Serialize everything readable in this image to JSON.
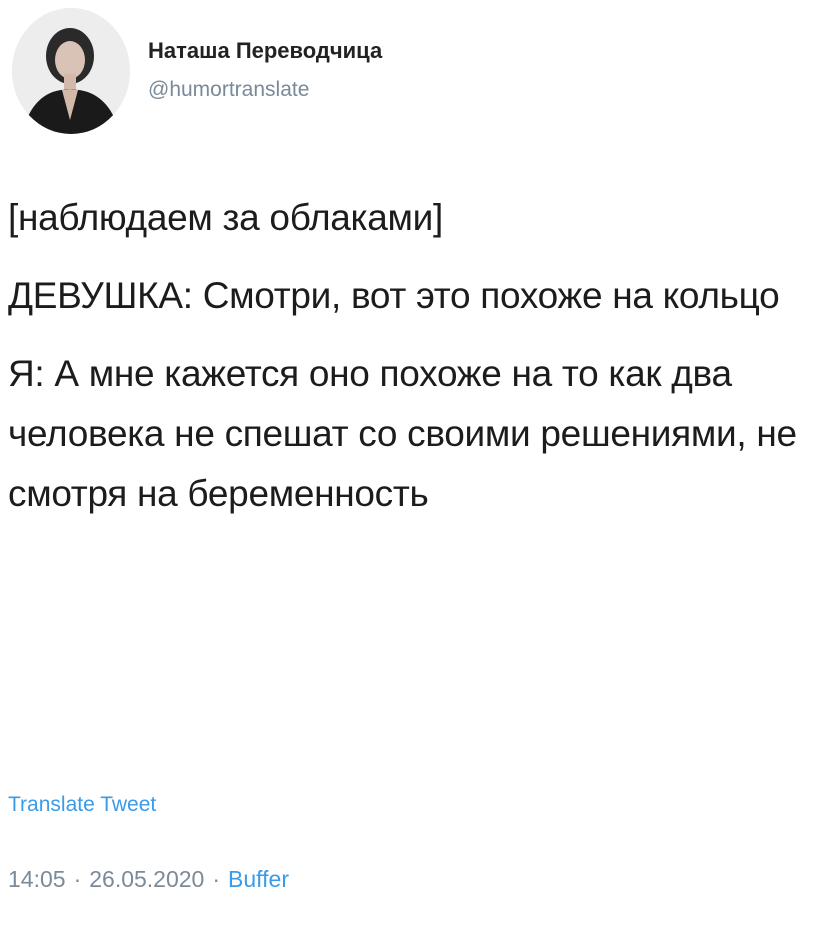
{
  "author": {
    "display_name": "Наташа Переводчица",
    "handle": "@humortranslate",
    "avatar_icon": "profile-photo"
  },
  "tweet": {
    "paragraphs": [
      "[наблюдаем за облаками]",
      "ДЕВУШКА: Смотри, вот это похоже на кольцо",
      "Я: А мне кажется оно похоже на то как два человека не спешат со своими решениями, не смотря на беременность"
    ],
    "translate_label": "Translate Tweet",
    "time": "14:05",
    "date": "26.05.2020",
    "separator": "·",
    "source": "Buffer"
  },
  "colors": {
    "text": "#1c1c1c",
    "muted": "#7a8a99",
    "link": "#3a9be8",
    "background": "#ffffff"
  }
}
